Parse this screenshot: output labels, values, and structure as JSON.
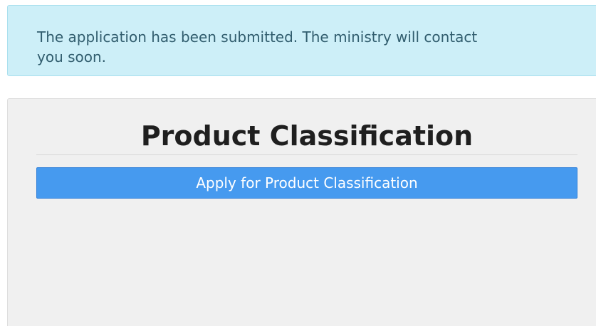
{
  "alert": {
    "message": "The application has been submitted. The ministry will contact you soon."
  },
  "panel": {
    "title": "Product Classification",
    "button_label": "Apply for Product Classification"
  },
  "colors": {
    "alert_background": "#cdeff8",
    "alert_text": "#315d6e",
    "panel_background": "#f0f0f0",
    "button_background": "#469aef",
    "button_text": "#ffffff"
  }
}
